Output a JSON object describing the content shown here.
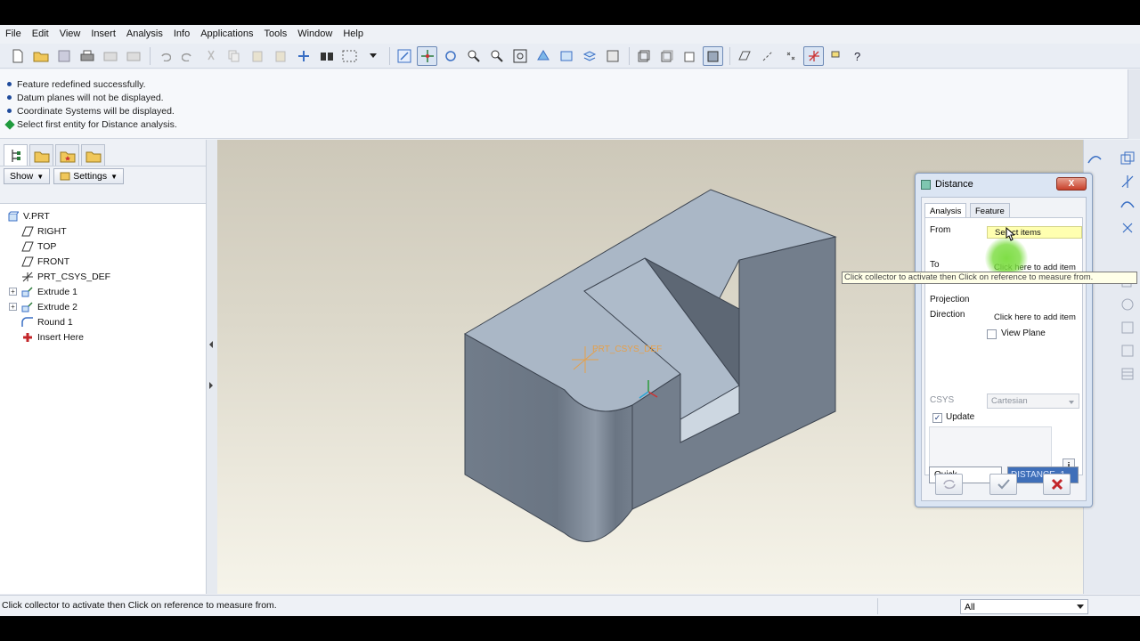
{
  "menu": [
    "File",
    "Edit",
    "View",
    "Insert",
    "Analysis",
    "Info",
    "Applications",
    "Tools",
    "Window",
    "Help"
  ],
  "messages": [
    {
      "type": "info",
      "text": "Feature redefined successfully."
    },
    {
      "type": "info",
      "text": "Datum planes will not be displayed."
    },
    {
      "type": "info",
      "text": "Coordinate Systems will be displayed."
    },
    {
      "type": "prompt",
      "text": "Select first entity for Distance analysis."
    }
  ],
  "model_tree": {
    "show_label": "Show",
    "settings_label": "Settings",
    "items": [
      {
        "label": "V.PRT",
        "icon": "part-icon"
      },
      {
        "label": "RIGHT",
        "icon": "datum-plane-icon"
      },
      {
        "label": "TOP",
        "icon": "datum-plane-icon"
      },
      {
        "label": "FRONT",
        "icon": "datum-plane-icon"
      },
      {
        "label": "PRT_CSYS_DEF",
        "icon": "csys-icon"
      },
      {
        "label": "Extrude 1",
        "icon": "extrude-icon"
      },
      {
        "label": "Extrude 2",
        "icon": "extrude-icon"
      },
      {
        "label": "Round 1",
        "icon": "round-icon"
      },
      {
        "label": "Insert Here",
        "icon": "insert-arrow-icon"
      }
    ]
  },
  "graphics": {
    "csys_label": "PRT_CSYS_DEF"
  },
  "dialog": {
    "title": "Distance",
    "close_label": "X",
    "tabs": [
      "Analysis",
      "Feature"
    ],
    "from_label": "From",
    "from_value": "Select items",
    "to_label": "To",
    "to_value": "Click here to add item",
    "projection_label": "Projection",
    "direction_label": "Direction",
    "direction_value": "Click here to add item",
    "view_plane_label": "View Plane",
    "csys_label": "CSYS",
    "csys_value": "Cartesian",
    "update_label": "Update",
    "update_checked": "✓",
    "mode_value": "Quick",
    "name_value": "DISTANCE_1",
    "info_label": "i"
  },
  "tooltip": "Click collector to activate then Click on reference to measure from.",
  "status": {
    "text": "Click collector to activate then Click on reference to measure from.",
    "filter_value": "All"
  },
  "colors": {
    "prompt_green": "#1f9a3d",
    "info_blue": "#1f4b9c",
    "highlight": "#7edc3c"
  }
}
